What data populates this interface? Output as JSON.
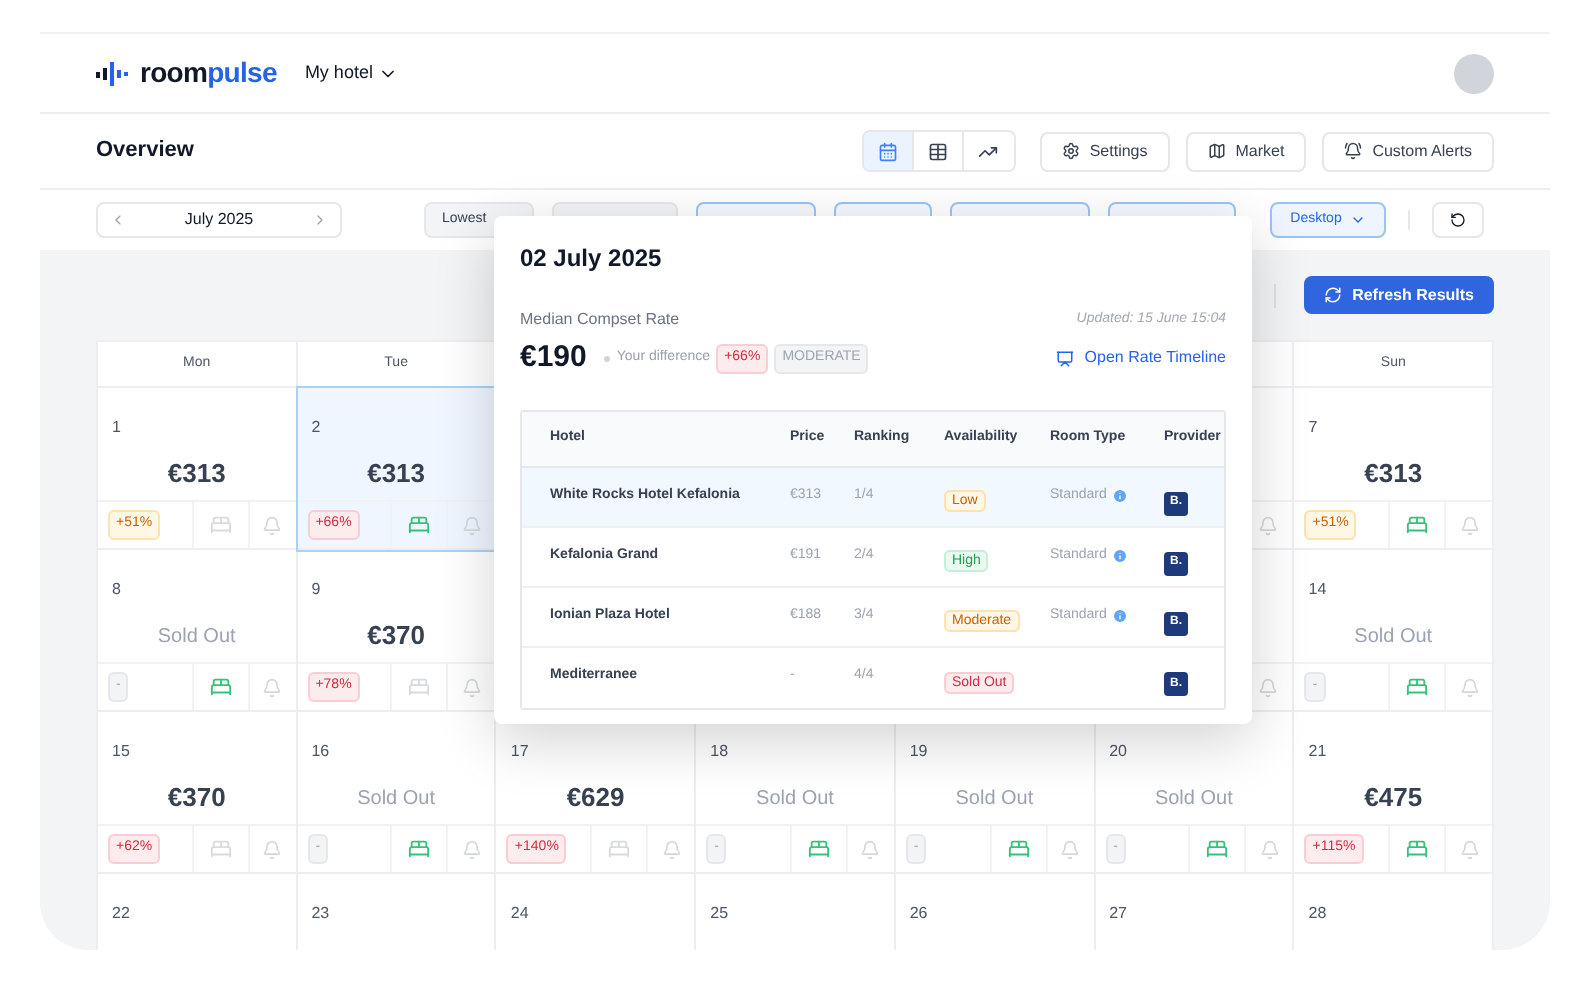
{
  "brand": {
    "name_start": "room",
    "name_end": "pulse"
  },
  "hotel_menu": {
    "label": "My hotel"
  },
  "page_title": "Overview",
  "view_toggle": [
    {
      "kind": "calendar",
      "selected": true
    },
    {
      "kind": "table",
      "selected": false
    },
    {
      "kind": "trend",
      "selected": false
    }
  ],
  "actions": [
    {
      "kind": "settings",
      "label": "Settings"
    },
    {
      "kind": "market",
      "label": "Market"
    },
    {
      "kind": "alerts",
      "label": "Custom Alerts"
    }
  ],
  "month_nav": {
    "label": "July 2025"
  },
  "filters": [
    {
      "label": "Lowest",
      "selected": false
    },
    {
      "selected": false
    },
    {
      "selected": true
    },
    {
      "selected": true
    },
    {
      "selected": true
    },
    {
      "selected": true
    }
  ],
  "device": {
    "label": "Desktop",
    "selected": true
  },
  "refresh_button": "Refresh Results",
  "calendar": {
    "weekdays": {
      "column_1": "Mon",
      "column_2": "Tue",
      "column_7": "Sun"
    },
    "weeks": [
      {
        "cells": [
          {
            "date": "1",
            "value": "€313",
            "sold_out": false,
            "diff": "+51%",
            "color": "#c2620a",
            "bed_available": false,
            "selected": false
          },
          {
            "date": "2",
            "value": "€313",
            "sold_out": false,
            "diff": "+66%",
            "color": "#d02a3e",
            "bed_available": true,
            "selected": true
          },
          {},
          {},
          {},
          {},
          {
            "date": "7",
            "value": "€313",
            "sold_out": false,
            "diff": "+51%",
            "color": "#c2620a",
            "bed_available": true,
            "selected": false
          }
        ]
      },
      {
        "cells": [
          {
            "date": "8",
            "value": "Sold Out",
            "sold_out": true,
            "diff": "-",
            "bed_available": true,
            "selected": false
          },
          {
            "date": "9",
            "value": "€370",
            "sold_out": false,
            "diff": "+78%",
            "color": "#d02a3e",
            "bed_available": false,
            "selected": false
          },
          {},
          {},
          {},
          {},
          {
            "date": "14",
            "value": "Sold Out",
            "sold_out": true,
            "diff": "-",
            "bed_available": true,
            "selected": false
          }
        ]
      },
      {
        "cells": [
          {
            "date": "15",
            "value": "€370",
            "sold_out": false,
            "diff": "+62%",
            "color": "#d02a3e",
            "bed_available": false,
            "selected": false
          },
          {
            "date": "16",
            "value": "Sold Out",
            "sold_out": true,
            "diff": "-",
            "bed_available": true,
            "selected": false
          },
          {
            "date": "17",
            "value": "€629",
            "sold_out": false,
            "diff": "+140%",
            "color": "#d02a3e",
            "bed_available": false,
            "selected": false
          },
          {
            "date": "18",
            "value": "Sold Out",
            "sold_out": true,
            "diff": "-",
            "bed_available": true,
            "selected": false
          },
          {
            "date": "19",
            "value": "Sold Out",
            "sold_out": true,
            "diff": "-",
            "bed_available": true,
            "selected": false
          },
          {
            "date": "20",
            "value": "Sold Out",
            "sold_out": true,
            "diff": "-",
            "bed_available": true,
            "selected": false
          },
          {
            "date": "21",
            "value": "€475",
            "sold_out": false,
            "diff": "+115%",
            "color": "#d02a3e",
            "bed_available": true,
            "selected": false
          }
        ]
      },
      {
        "cells": [
          {
            "date": "22"
          },
          {
            "date": "23"
          },
          {
            "date": "24"
          },
          {
            "date": "25"
          },
          {
            "date": "26"
          },
          {
            "date": "27"
          },
          {
            "date": "28"
          }
        ]
      }
    ]
  },
  "popover": {
    "title": "02 July 2025",
    "rate_label": "Median Compset Rate",
    "updated": "Updated: 15 June 15:04",
    "rate": "€190",
    "difference_label": "Your difference",
    "difference": "+66%",
    "level_tag": "MODERATE",
    "timeline_link": "Open Rate Timeline",
    "columns": [
      "Hotel",
      "Price",
      "Ranking",
      "Availability",
      "Room Type",
      "Provider"
    ],
    "rows": [
      {
        "hotel": "White Rocks Hotel Kefalonia",
        "price": "€313",
        "ranking": "1/4",
        "availability": "Low",
        "color": "#c2620a",
        "room_type": "Standard",
        "provider": "B.",
        "selected": true
      },
      {
        "hotel": "Kefalonia Grand",
        "price": "€191",
        "ranking": "2/4",
        "availability": "High",
        "color": "#1f9d55",
        "room_type": "Standard",
        "provider": "B.",
        "selected": false
      },
      {
        "hotel": "Ionian Plaza Hotel",
        "price": "€188",
        "ranking": "3/4",
        "availability": "Moderate",
        "color": "#c2620a",
        "room_type": "Standard",
        "provider": "B.",
        "selected": false
      },
      {
        "hotel": "Mediterranee",
        "price": "-",
        "ranking": "4/4",
        "availability": "Sold Out",
        "color": "#d02a3e",
        "provider": "B.",
        "selected": false
      }
    ]
  }
}
